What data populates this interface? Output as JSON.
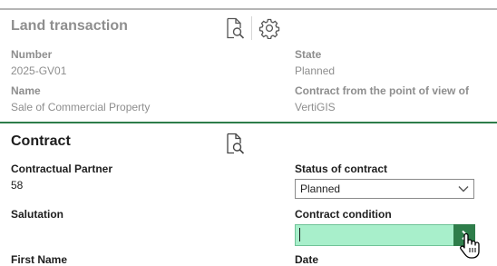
{
  "land_transaction": {
    "title": "Land transaction",
    "fields": {
      "number": {
        "label": "Number",
        "value": "2025-GV01"
      },
      "state": {
        "label": "State",
        "value": "Planned"
      },
      "name": {
        "label": "Name",
        "value": "Sale of Commercial Property"
      },
      "contract_pov": {
        "label": "Contract from the point of view of",
        "value": "VertiGIS"
      }
    },
    "icons": [
      "document-search-icon",
      "gear-icon"
    ]
  },
  "contract": {
    "title": "Contract",
    "fields": {
      "contractual_partner": {
        "label": "Contractual Partner",
        "value": "58"
      },
      "status": {
        "label": "Status of contract",
        "selected": "Planned"
      },
      "salutation": {
        "label": "Salutation"
      },
      "condition": {
        "label": "Contract condition",
        "value": ""
      },
      "first_name": {
        "label": "First Name"
      },
      "date": {
        "label": "Date"
      }
    },
    "icons": [
      "document-search-icon",
      "chevron-down-icon",
      "chevron-right-icon",
      "hand-pointer-icon"
    ]
  },
  "colors": {
    "accent_green": "#2e7d4a",
    "input_highlight": "#a8efcb",
    "muted_text": "#8e8e8e"
  }
}
